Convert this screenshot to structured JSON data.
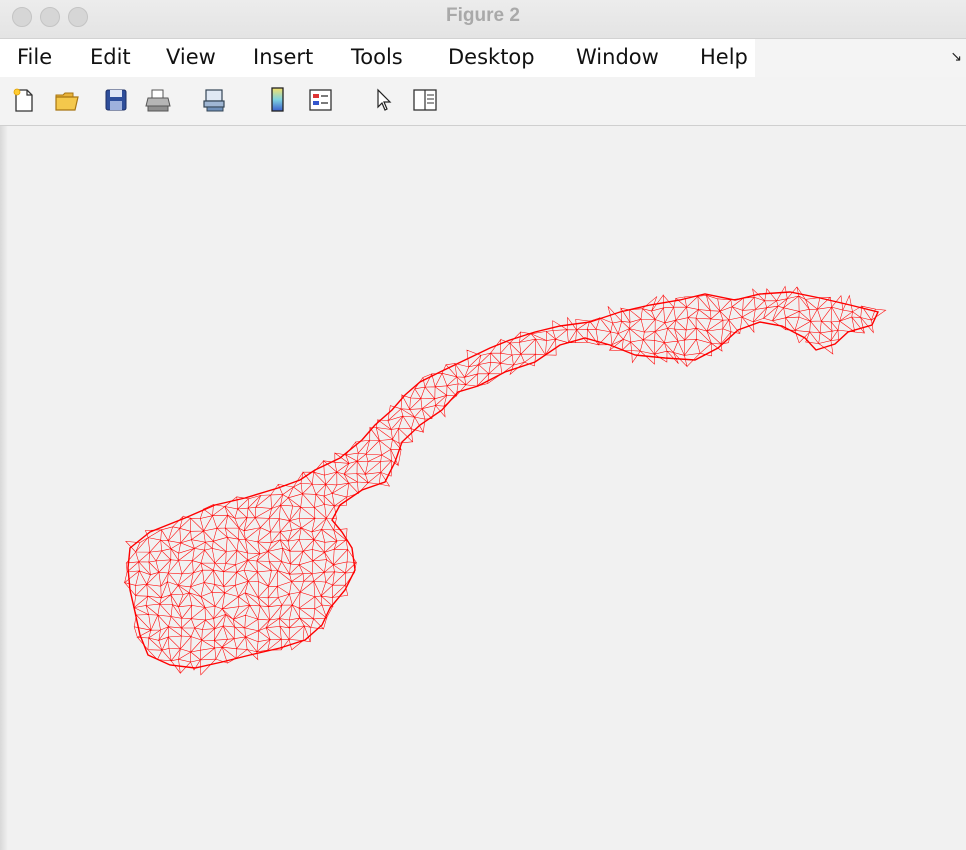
{
  "window": {
    "title": "Figure 2",
    "controls": [
      "close",
      "minimize",
      "zoom"
    ]
  },
  "menu": {
    "items": [
      "File",
      "Edit",
      "View",
      "Insert",
      "Tools",
      "Desktop",
      "Window",
      "Help"
    ],
    "overflow_icon": "arrow-down-right-icon"
  },
  "toolbar": {
    "buttons": [
      {
        "name": "new-figure-button",
        "icon": "new-file-icon"
      },
      {
        "name": "open-file-button",
        "icon": "folder-open-icon"
      },
      {
        "name": "save-figure-button",
        "icon": "floppy-disk-icon"
      },
      {
        "name": "print-figure-button",
        "icon": "printer-icon"
      },
      {
        "name": "link-plot-button",
        "icon": "link-plot-icon"
      },
      {
        "name": "insert-colorbar-button",
        "icon": "colorbar-icon"
      },
      {
        "name": "insert-legend-button",
        "icon": "legend-icon"
      },
      {
        "name": "edit-plot-button",
        "icon": "arrow-pointer-icon"
      },
      {
        "name": "show-plot-tools-button",
        "icon": "plot-tools-icon"
      }
    ]
  },
  "figure": {
    "content": "triangular mesh",
    "mesh_color": "#ff0000",
    "background": "#f1f1f1",
    "axes_visible": false
  }
}
